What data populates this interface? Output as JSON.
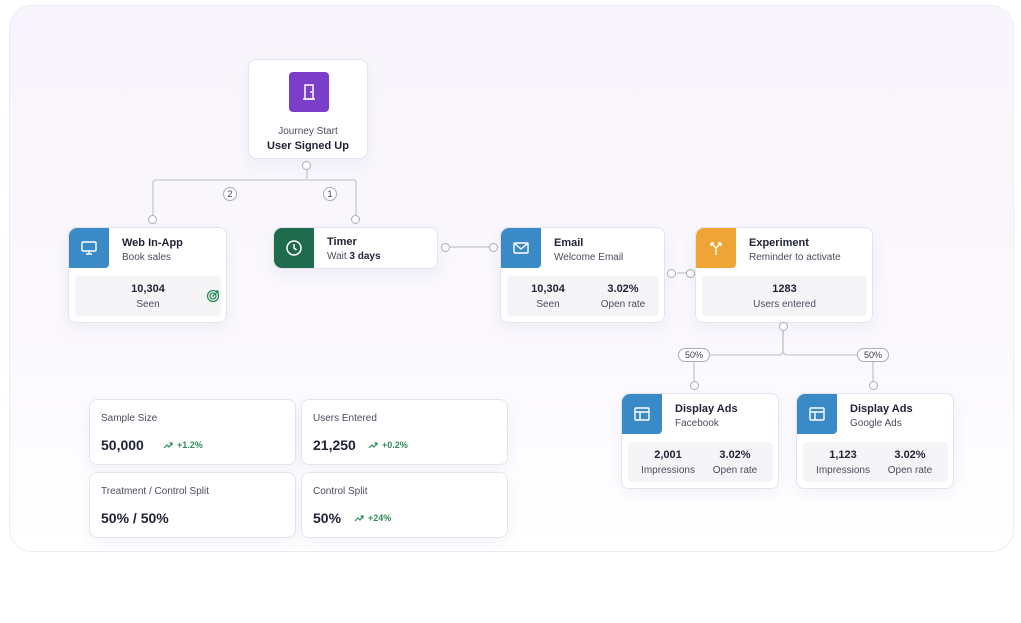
{
  "colors": {
    "purple": "#7a3ec9",
    "blue": "#3b8ac8",
    "green": "#1f6b4e",
    "orange": "#eea535",
    "trend_green": "#2f8a5b"
  },
  "journey_start": {
    "icon": "door-icon",
    "caption": "Journey Start",
    "title": "User Signed Up"
  },
  "branches": {
    "left_badge": "2",
    "right_badge": "1"
  },
  "web_in_app": {
    "icon": "monitor-icon",
    "title": "Web In-App",
    "subtitle": "Book sales",
    "seen_value": "10,304",
    "seen_label": "Seen",
    "goal_icon": "target-icon"
  },
  "timer": {
    "icon": "clock-icon",
    "title": "Timer",
    "subtitle_prefix": "Wait",
    "subtitle_value": "3 days"
  },
  "email": {
    "icon": "envelope-icon",
    "title": "Email",
    "subtitle": "Welcome Email",
    "stats": [
      {
        "value": "10,304",
        "label": "Seen"
      },
      {
        "value": "3.02%",
        "label": "Open rate"
      }
    ]
  },
  "experiment": {
    "icon": "split-icon",
    "title": "Experiment",
    "subtitle": "Reminder to activate",
    "users_value": "1283",
    "users_label": "Users entered",
    "left_split": "50%",
    "right_split": "50%"
  },
  "display_ads_facebook": {
    "icon": "layout-icon",
    "title": "Display Ads",
    "subtitle": "Facebook",
    "stats": [
      {
        "value": "2,001",
        "label": "Impressions"
      },
      {
        "value": "3.02%",
        "label": "Open rate"
      }
    ]
  },
  "display_ads_google": {
    "icon": "layout-icon",
    "title": "Display Ads",
    "subtitle": "Google Ads",
    "stats": [
      {
        "value": "1,123",
        "label": "Impressions"
      },
      {
        "value": "3.02%",
        "label": "Open rate"
      }
    ]
  },
  "metrics": {
    "sample_size": {
      "label": "Sample Size",
      "value": "50,000",
      "trend": "+1.2%"
    },
    "users_entered": {
      "label": "Users Entered",
      "value": "21,250",
      "trend": "+0.2%"
    },
    "treatment_split": {
      "label": "Treatment / Control Split",
      "value": "50% / 50%"
    },
    "control_split": {
      "label": "Control Split",
      "value": "50%",
      "trend": "+24%"
    }
  }
}
